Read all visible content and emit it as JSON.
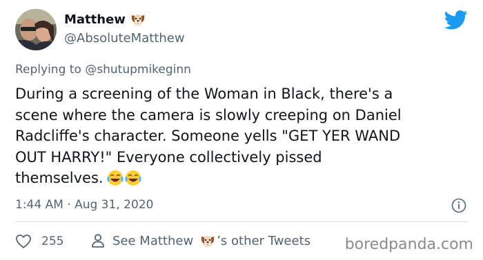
{
  "user": {
    "display_name": "Matthew",
    "handle": "@AbsoluteMatthew",
    "name_emoji": "dog-face-emoji"
  },
  "brand": {
    "logo": "twitter-bird-icon",
    "accent_color": "#1d9bf0"
  },
  "reply": {
    "prefix": "Replying to",
    "mention": "@shutupmikeginn"
  },
  "tweet": {
    "lines": [
      "During a screening of the Woman in Black, there's a",
      "scene where the camera is slowly creeping on Daniel",
      "Radcliffe's character. Someone yells \"GET YER WAND",
      "OUT HARRY!\" Everyone collectively pissed",
      "themselves."
    ],
    "trailing_emoji": "face-with-tears-of-joy-emoji",
    "timestamp": "1:44 AM · Aug 31, 2020"
  },
  "actions": {
    "like_count": "255",
    "see_more_prefix": "See Matthew",
    "see_more_suffix": "’s other Tweets"
  },
  "watermark": "boredpanda.com"
}
